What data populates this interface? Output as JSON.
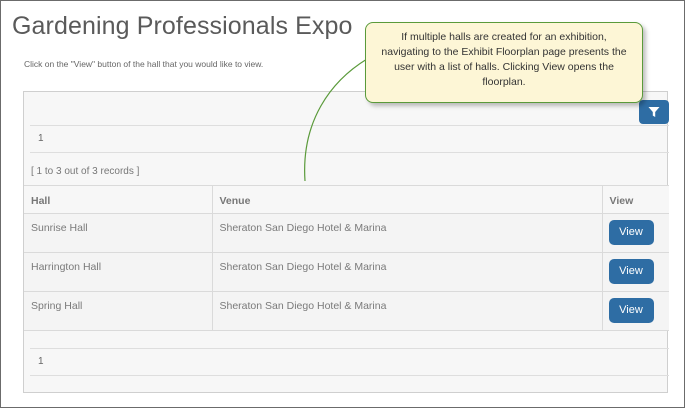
{
  "page": {
    "title": "Gardening Professionals Expo",
    "instructions": "Click on the \"View\" button of the hall that you would like to view."
  },
  "filter": {
    "icon": "filter-icon"
  },
  "pager": {
    "top_page": "1",
    "bottom_page": "1"
  },
  "records_summary": "[ 1 to 3 out of 3 records ]",
  "table": {
    "headers": {
      "hall": "Hall",
      "venue": "Venue",
      "view": "View"
    },
    "rows": [
      {
        "hall": "Sunrise Hall",
        "venue": "Sheraton San Diego Hotel & Marina",
        "action": "View"
      },
      {
        "hall": "Harrington Hall",
        "venue": "Sheraton San Diego Hotel & Marina",
        "action": "View"
      },
      {
        "hall": "Spring Hall",
        "venue": "Sheraton San Diego Hotel & Marina",
        "action": "View"
      }
    ]
  },
  "callout": {
    "text": "If multiple halls are created for an exhibition, navigating to the Exhibit Floorplan page presents the user with a list of halls.  Clicking View opens the floorplan."
  },
  "colors": {
    "button": "#2e6da4",
    "callout_bg": "#fdf6d6",
    "callout_border": "#5a9a3a"
  }
}
